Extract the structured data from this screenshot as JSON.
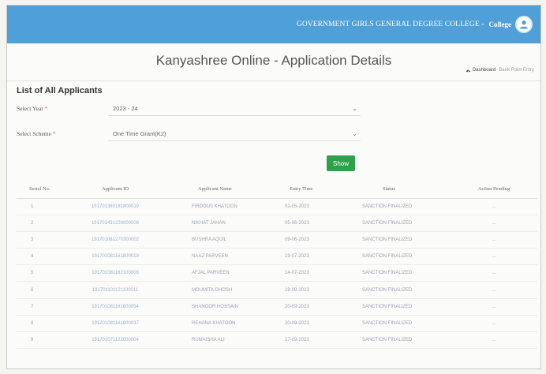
{
  "header": {
    "college_name": "GOVERNMENT GIRLS GENERAL DEGREE COLLEGE",
    "separator": "-",
    "role": "College"
  },
  "page": {
    "title": "Kanyashree Online - Application Details"
  },
  "breadcrumb": {
    "dashboard": "Dashboard",
    "current": "Bank Point Entry"
  },
  "section": {
    "title": "List of All Applicants"
  },
  "filters": {
    "year_label": "Select Year",
    "year_value": "2023 - 24",
    "scheme_label": "Select Scheme",
    "scheme_value": "One Time Grant(K2)",
    "required_mark": "*",
    "show_button": "Show"
  },
  "table": {
    "columns": [
      "Serial No.",
      "Applicant ID",
      "Applicant Name",
      "Entry Time",
      "Status",
      "Action Pending"
    ],
    "rows": [
      {
        "serial": "1",
        "id": "191701380181800019",
        "name": "FIRDOUS KHATOON",
        "time": "02-05-2023",
        "status": "SANCTION FINALIZED",
        "action": "..."
      },
      {
        "serial": "2",
        "id": "191701431220000008",
        "name": "NIKHAT JAHAN",
        "time": "05-06-2023",
        "status": "SANCTION FINALIZED",
        "action": "..."
      },
      {
        "serial": "3",
        "id": "191701081270300002",
        "name": "BUSHRA AQUIL",
        "time": "09-06-2023",
        "status": "SANCTION FINALIZED",
        "action": "..."
      },
      {
        "serial": "4",
        "id": "191701081161800019",
        "name": "NAAZ PARVEEN",
        "time": "19-07-2023",
        "status": "SANCTION FINALIZED",
        "action": "..."
      },
      {
        "serial": "5",
        "id": "191701081162100008",
        "name": "AFJAL PARVEEN",
        "time": "14-07-2023",
        "status": "SANCTION FINALIZED",
        "action": "..."
      },
      {
        "serial": "6",
        "id": "191701101121100011",
        "name": "MOUMITA GHOSH",
        "time": "19-09-2023",
        "status": "SANCTION FINALIZED",
        "action": "..."
      },
      {
        "serial": "7",
        "id": "191701081161800054",
        "name": "SHANOOR HOSSAIN",
        "time": "20-09-2023",
        "status": "SANCTION FINALIZED",
        "action": "..."
      },
      {
        "serial": "8",
        "id": "191701081161800037",
        "name": "REHANA KHATOON",
        "time": "20-09-2023",
        "status": "SANCTION FINALIZED",
        "action": "..."
      },
      {
        "serial": "9",
        "id": "191701071122000004",
        "name": "RUMAISHA ALI",
        "time": "27-09-2023",
        "status": "SANCTION FINALIZED",
        "action": "..."
      }
    ]
  },
  "colors": {
    "header_bg": "#4f9fd9",
    "show_button": "#2fa04b"
  },
  "icons": {
    "avatar": "user-avatar-icon",
    "dashboard": "dashboard-icon",
    "dropdown": "chevron-down-icon"
  }
}
